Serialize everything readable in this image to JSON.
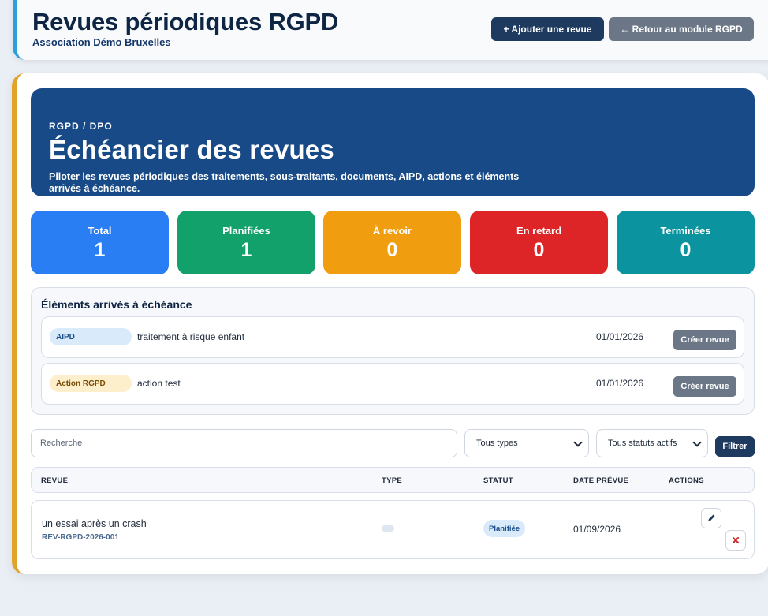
{
  "header": {
    "title": "Revues périodiques RGPD",
    "subtitle": "Association Démo Bruxelles",
    "add_button": "+ Ajouter une revue",
    "back_button": "← Retour au module RGPD"
  },
  "hero": {
    "kicker": "RGPD / DPO",
    "title": "Échéancier des revues",
    "description": "Piloter les revues périodiques des traitements, sous-traitants, documents, AIPD, actions et éléments arrivés à échéance."
  },
  "stats": [
    {
      "label": "Total",
      "value": "1",
      "color": "#2a7ef3"
    },
    {
      "label": "Planifiées",
      "value": "1",
      "color": "#12a06b"
    },
    {
      "label": "À revoir",
      "value": "0",
      "color": "#f09e10"
    },
    {
      "label": "En retard",
      "value": "0",
      "color": "#dd2528"
    },
    {
      "label": "Terminées",
      "value": "0",
      "color": "#0b949f"
    }
  ],
  "due": {
    "heading": "Éléments arrivés à échéance",
    "items": [
      {
        "badge": "AIPD",
        "label": "traitement à risque enfant",
        "date": "01/01/2026",
        "button": "Créer revue"
      },
      {
        "badge": "Action RGPD",
        "label": "action test",
        "date": "01/01/2026",
        "button": "Créer revue"
      }
    ]
  },
  "filters": {
    "search_placeholder": "Recherche",
    "type_selected": "Tous types",
    "status_selected": "Tous statuts actifs",
    "filter_button": "Filtrer"
  },
  "table": {
    "headers": [
      "REVUE",
      "TYPE",
      "STATUT",
      "DATE PRÉVUE",
      "ACTIONS"
    ],
    "rows": [
      {
        "name": "un essai après un crash",
        "ref": "REV-RGPD-2026-001",
        "type": "",
        "status": "Planifiée",
        "date": "01/09/2026"
      }
    ]
  },
  "icons": {
    "edit": "pencil-icon",
    "delete": "close-icon",
    "chevron": "chevron-down-icon"
  }
}
